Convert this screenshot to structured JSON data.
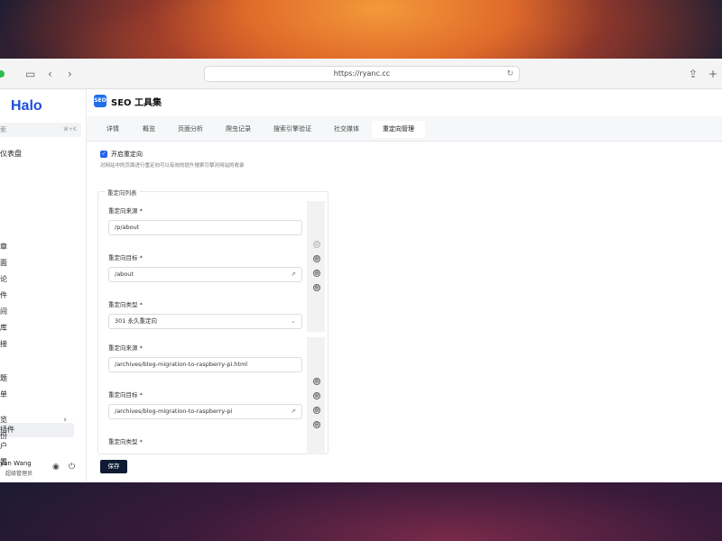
{
  "browser": {
    "url": "https://ryanc.cc"
  },
  "sidebar": {
    "logo": "Halo",
    "search_placeholder": "索",
    "search_shortcut": "⌘+K",
    "items": [
      {
        "label": "仪表盘"
      },
      {
        "label": "文章"
      },
      {
        "label": "页面"
      },
      {
        "label": "评论"
      },
      {
        "label": "附件"
      },
      {
        "label": "瞬间"
      },
      {
        "label": "图库"
      },
      {
        "label": "链接"
      },
      {
        "label": "主题"
      },
      {
        "label": "菜单"
      },
      {
        "label": "插件"
      },
      {
        "label": "用户"
      },
      {
        "label": "设置"
      },
      {
        "label": "概览"
      },
      {
        "label": "备份"
      }
    ],
    "user": {
      "name": "yan Wang",
      "role": "超级管理员"
    }
  },
  "page": {
    "badge": "SEO",
    "title": "SEO 工具集",
    "tabs": [
      "详情",
      "概览",
      "页面分析",
      "爬虫记录",
      "搜索引擎验证",
      "社交媒体",
      "重定向管理"
    ],
    "active_tab": "重定向管理",
    "enable_label": "开启重定向",
    "help_text": "对网站中的页面进行重定向可以有效的提升搜索引擎对网站的收录",
    "list_legend": "重定向列表",
    "redirects": [
      {
        "source_label": "重定向来源 *",
        "source": "/p/about",
        "target_label": "重定向目标 *",
        "target": "/about",
        "type_label": "重定向类型 *",
        "type": "301 永久重定向"
      },
      {
        "source_label": "重定向来源 *",
        "source": "/archives/blog-migration-to-raspberry-pi.html",
        "target_label": "重定向目标 *",
        "target": "/archives/blog-migration-to-raspberry-pi",
        "type_label": "重定向类型 *",
        "type": ""
      }
    ],
    "save_label": "保存"
  },
  "colors": {
    "accent": "#2563eb",
    "save_button": "#0f1b33",
    "logo": "#1d4ed8"
  }
}
